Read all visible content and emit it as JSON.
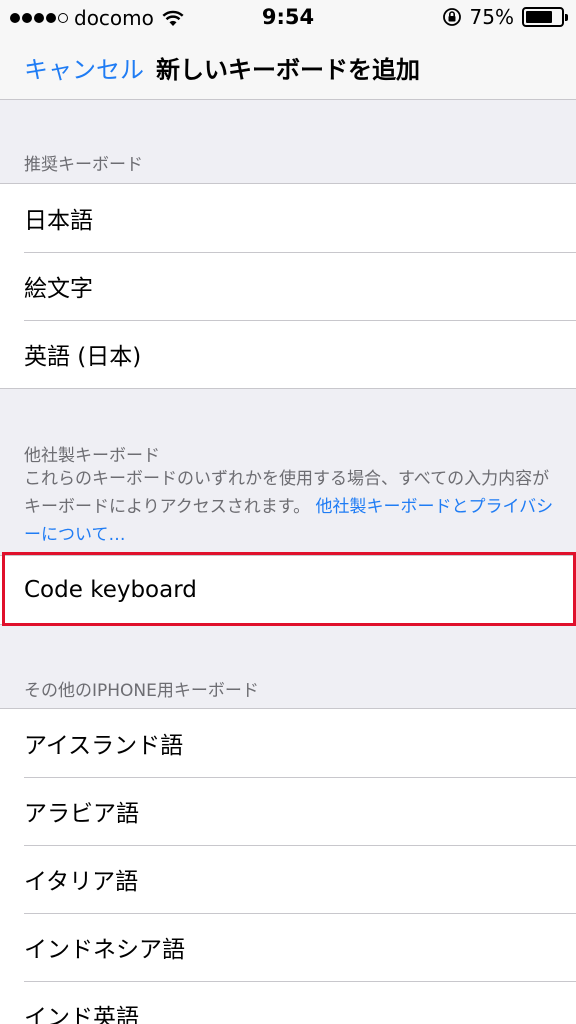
{
  "status_bar": {
    "carrier": "docomo",
    "time": "9:54",
    "battery_percent": "75%",
    "battery_level": 0.75,
    "signal_bars_filled": 4,
    "signal_bars_total": 5
  },
  "nav": {
    "cancel_label": "キャンセル",
    "title": "新しいキーボードを追加"
  },
  "recommended": {
    "header": "推奨キーボード",
    "items": [
      {
        "label": "日本語"
      },
      {
        "label": "絵文字"
      },
      {
        "label": "英語 (日本)"
      }
    ]
  },
  "third_party": {
    "header": "他社製キーボード",
    "description": "これらのキーボードのいずれかを使用する場合、すべての入力内容がキーボードによりアクセスされます。",
    "privacy_link": "他社製キーボードとプライバシーについて…",
    "items": [
      {
        "label": "Code keyboard"
      }
    ]
  },
  "other": {
    "header": "その他のIPHONE用キーボード",
    "items": [
      {
        "label": "アイスランド語"
      },
      {
        "label": "アラビア語"
      },
      {
        "label": "イタリア語"
      },
      {
        "label": "インドネシア語"
      },
      {
        "label": "インド英語"
      }
    ]
  },
  "colors": {
    "accent": "#1f7cf4",
    "highlight": "#e0102b",
    "background": "#efeff4"
  }
}
